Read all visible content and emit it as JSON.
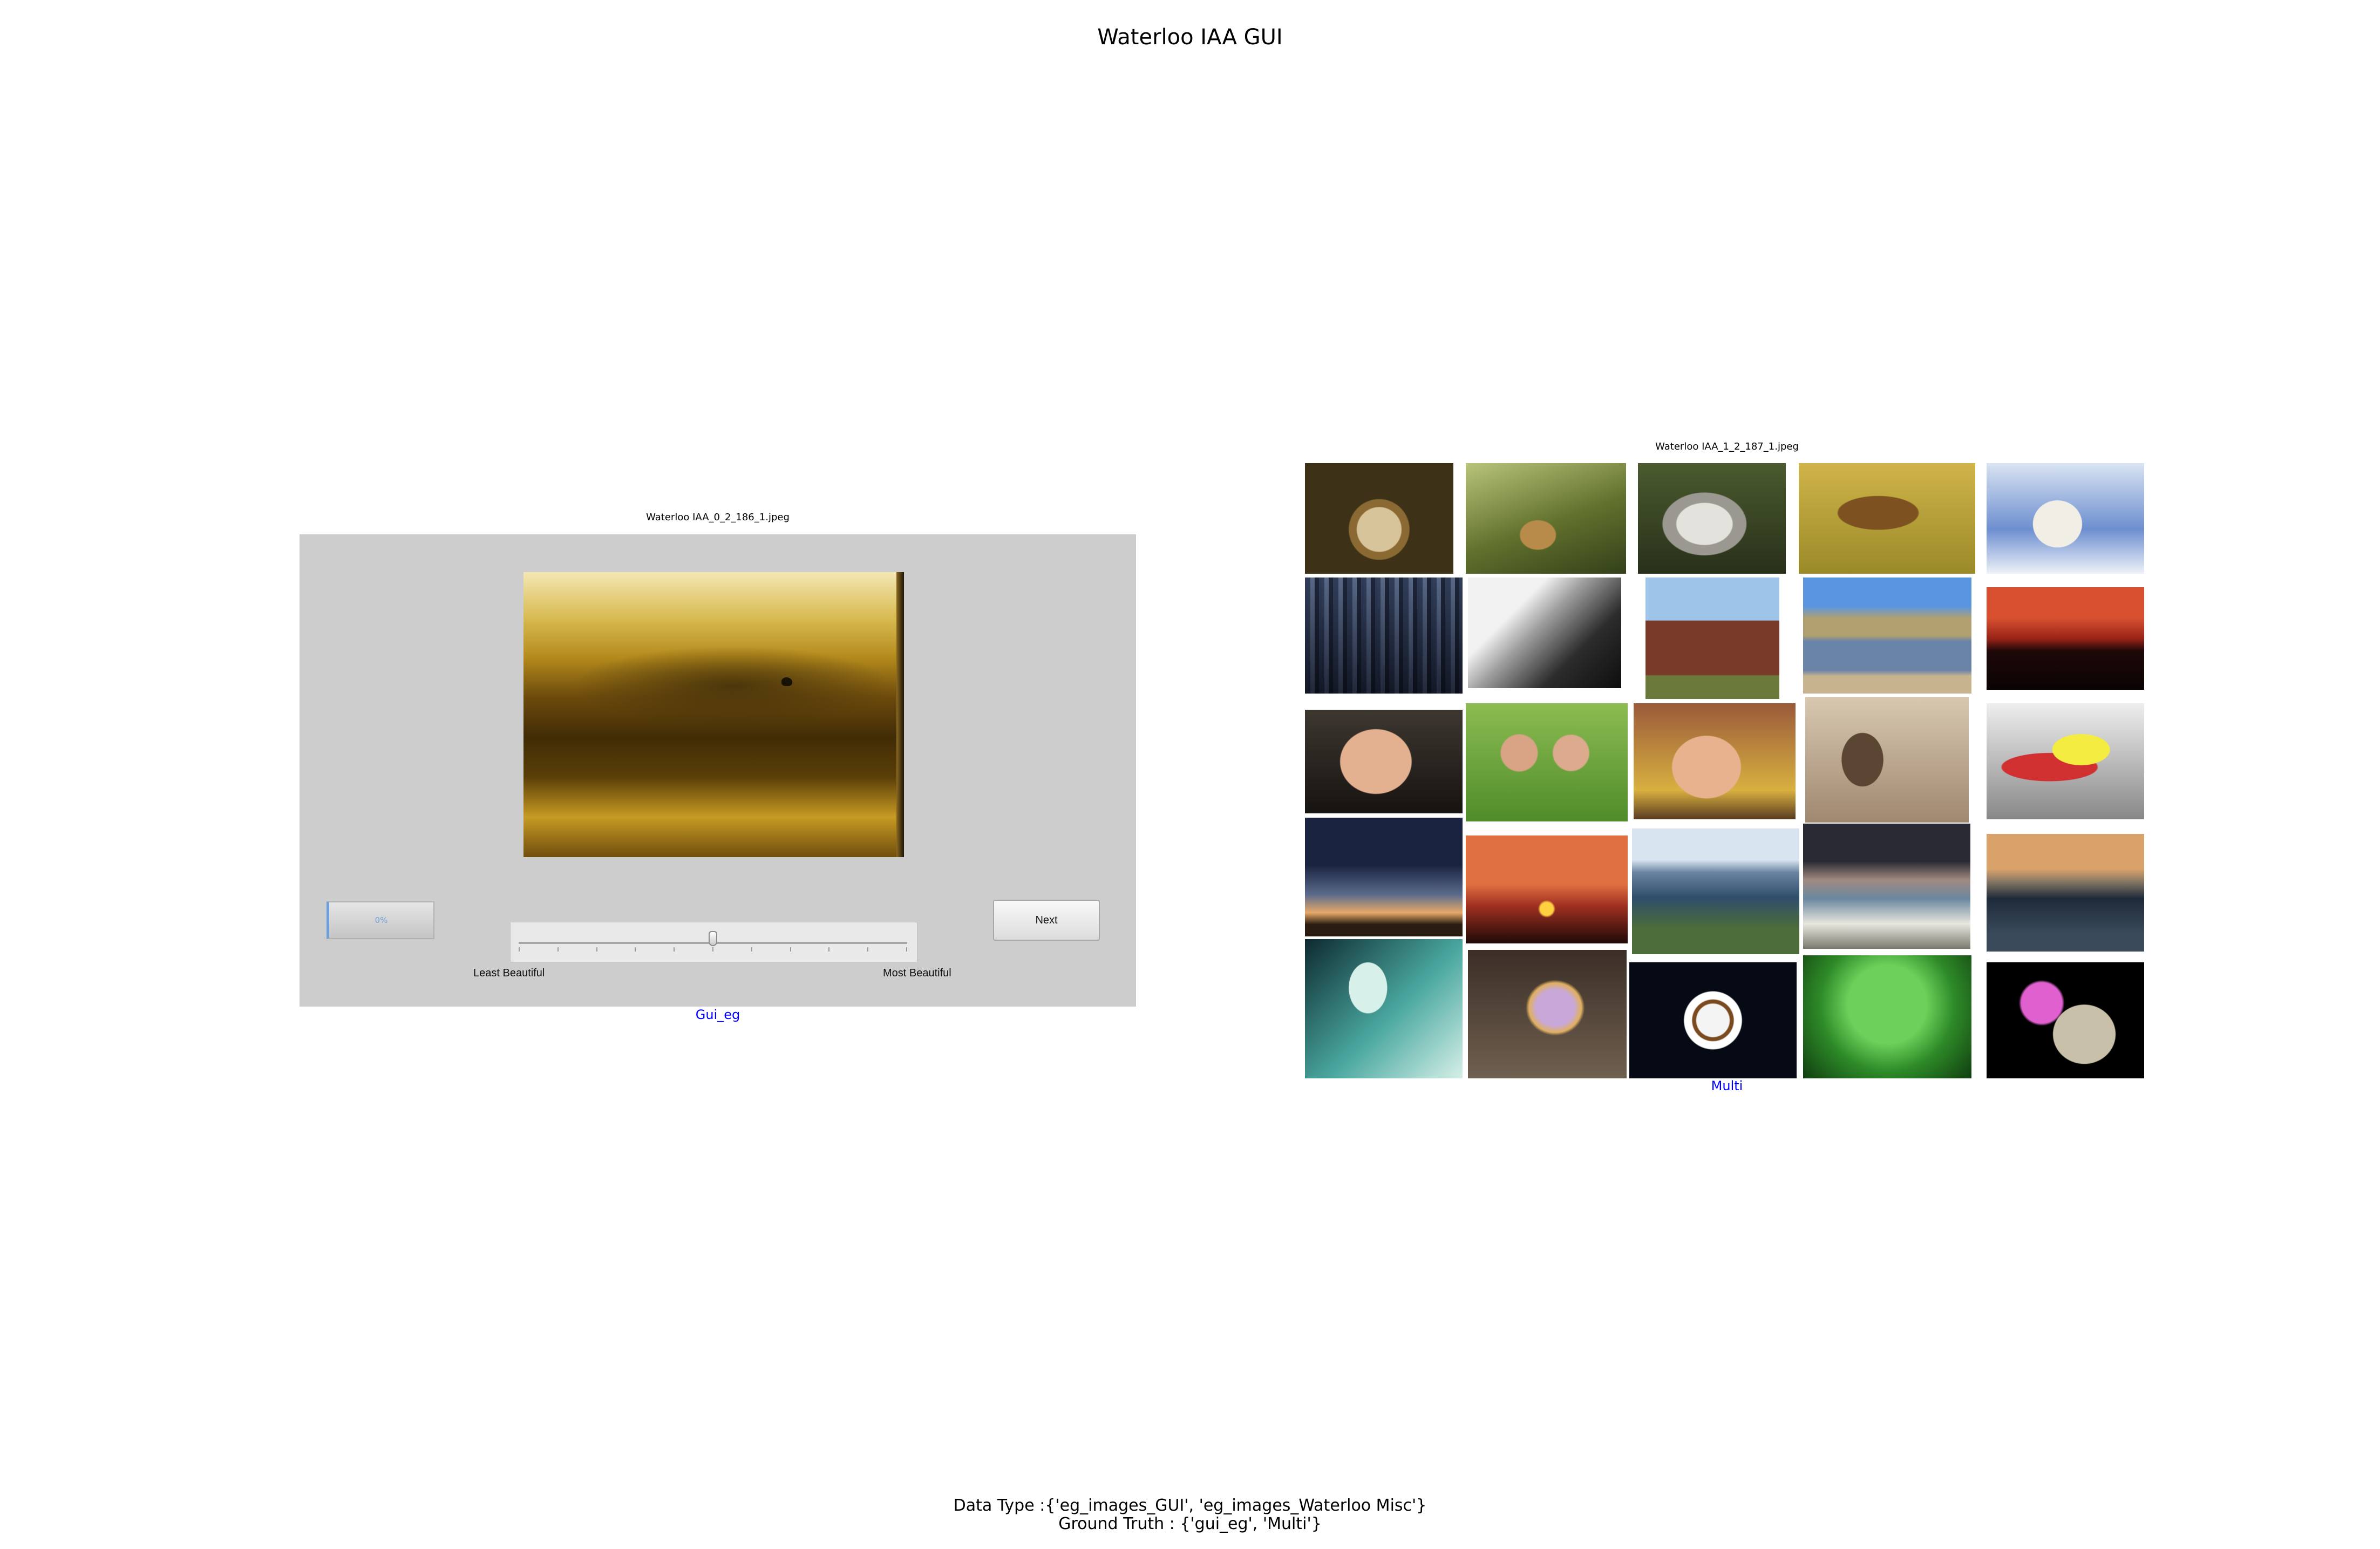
{
  "title": "Waterloo IAA GUI",
  "gui_example": {
    "caption": "Waterloo IAA_0_2_186_1.jpeg",
    "progress_text": "0%",
    "progress_value": 0,
    "next_label": "Next",
    "slider": {
      "min_label": "Least Beautiful",
      "max_label": "Most Beautiful",
      "value_fraction": 0.5,
      "tick_count": 11
    },
    "link": "Gui_eg"
  },
  "collage": {
    "caption": "Waterloo IAA_1_2_187_1.jpeg",
    "link": "Multi",
    "thumbnails": [
      {
        "name": "snail-photo"
      },
      {
        "name": "fox-in-forest-photo"
      },
      {
        "name": "vulture-photo"
      },
      {
        "name": "flying-owl-photo"
      },
      {
        "name": "polar-bear-photo"
      },
      {
        "name": "city-aerial-photo"
      },
      {
        "name": "carved-sign-photo"
      },
      {
        "name": "old-barn-photo"
      },
      {
        "name": "castle-reflection-photo"
      },
      {
        "name": "skyline-sunset-photo"
      },
      {
        "name": "man-with-glasses-photo"
      },
      {
        "name": "two-girls-photo"
      },
      {
        "name": "child-lying-photo"
      },
      {
        "name": "sepia-person-photo"
      },
      {
        "name": "ski-racer-photo"
      },
      {
        "name": "dusk-tree-photo"
      },
      {
        "name": "sea-sunset-photo"
      },
      {
        "name": "mountain-lake-photo"
      },
      {
        "name": "stormy-beach-photo"
      },
      {
        "name": "calm-lake-photo"
      },
      {
        "name": "wine-glass-photo"
      },
      {
        "name": "colorful-glove-photo"
      },
      {
        "name": "coffee-cup-photo"
      },
      {
        "name": "green-leaf-photo"
      },
      {
        "name": "cactus-flower-photo"
      }
    ]
  },
  "footer": {
    "data_type": "Data Type :{'eg_images_GUI', 'eg_images_Waterloo Misc'}",
    "ground_truth": "Ground Truth : {'gui_eg', 'Multi'}"
  }
}
